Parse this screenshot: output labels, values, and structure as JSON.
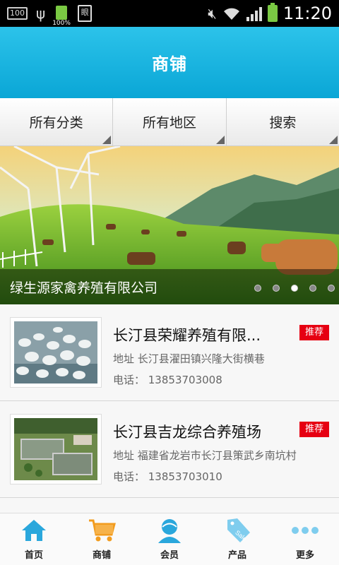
{
  "status_bar": {
    "left_box_text": "100",
    "battery_small_label": "100%",
    "doc_icon_text": "眼",
    "time": "11:20"
  },
  "header": {
    "title": "商铺"
  },
  "filters": [
    {
      "label": "所有分类"
    },
    {
      "label": "所有地区"
    },
    {
      "label": "搜索"
    }
  ],
  "banner": {
    "title": "绿生源家禽养殖有限公司",
    "dots": 5,
    "active_dot": 2
  },
  "shops": [
    {
      "name": "长汀县荣耀养殖有限...",
      "badge": "推荐",
      "address": "地址  长汀县濯田镇兴隆大街横巷",
      "phone": "电话：  13853703008",
      "thumb": "geese-icon"
    },
    {
      "name": "长汀县吉龙综合养殖场",
      "badge": "推荐",
      "address": "地址  福建省龙岩市长汀县策武乡南坑村",
      "phone": "电话：  13853703010",
      "thumb": "farm-pond-icon"
    }
  ],
  "bottom_nav": [
    {
      "label": "首页",
      "icon": "home-icon"
    },
    {
      "label": "商铺",
      "icon": "cart-icon"
    },
    {
      "label": "会员",
      "icon": "user-icon"
    },
    {
      "label": "产品",
      "icon": "sale-tag-icon"
    },
    {
      "label": "更多",
      "icon": "more-dots-icon"
    }
  ],
  "colors": {
    "header": "#0aa6d6",
    "badge": "#e60012",
    "nav_icon": "#2aa7dc",
    "cart_icon": "#f29c1f"
  }
}
